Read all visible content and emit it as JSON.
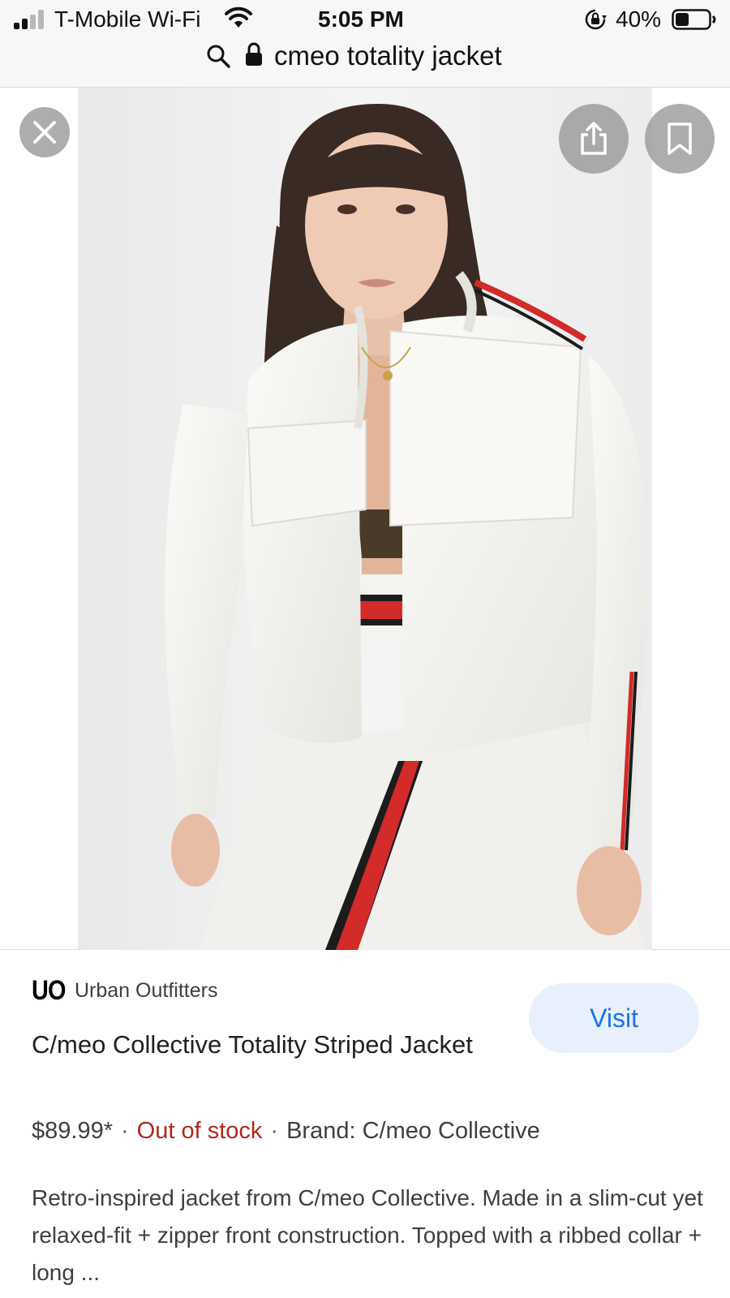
{
  "status_bar": {
    "carrier": "T-Mobile Wi-Fi",
    "time": "5:05 PM",
    "battery_percent": "40%",
    "battery_level": 0.4,
    "signal_bars_active": 2,
    "signal_bars_total": 4,
    "icons": [
      "signal-icon",
      "wifi-icon",
      "orientation-lock-icon",
      "battery-icon"
    ]
  },
  "url_bar": {
    "query": "cmeo totality jacket",
    "icons": [
      "search-icon",
      "lock-icon"
    ]
  },
  "image_viewer": {
    "icons": [
      "close-icon",
      "share-icon",
      "bookmark-icon"
    ]
  },
  "product": {
    "merchant_logo": "UO",
    "merchant_name": "Urban Outfitters",
    "visit_label": "Visit",
    "title": "C/meo Collective Totality Striped Jacket",
    "price": "$89.99*",
    "separator": "·",
    "stock_status": "Out of stock",
    "brand": "Brand: C/meo Collective",
    "description": "Retro-inspired jacket from C/meo Collective. Made in a slim-cut yet relaxed-fit + zipper front construction. Topped with a ribbed collar + long ..."
  },
  "colors": {
    "out_of_stock": "#b3261e",
    "visit_button_bg": "#e8f0fe",
    "visit_button_text": "#1a73e8",
    "stripe_red": "#d32a2a",
    "jacket_white": "#f6f5f1"
  }
}
